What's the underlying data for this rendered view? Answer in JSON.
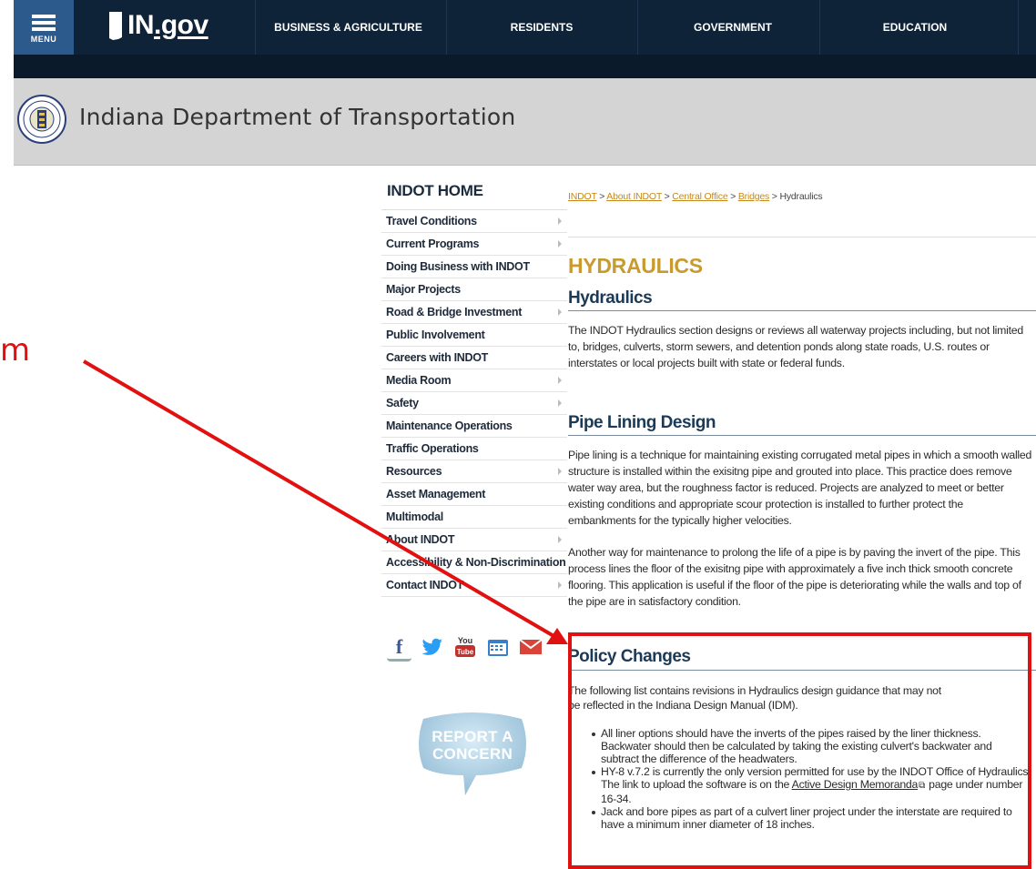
{
  "topnav": {
    "menu_label": "MENU",
    "logo_text": "IN",
    "logo_suffix": ".gov",
    "items": [
      {
        "label": "BUSINESS & AGRICULTURE"
      },
      {
        "label": "RESIDENTS"
      },
      {
        "label": "GOVERNMENT"
      },
      {
        "label": "EDUCATION"
      }
    ]
  },
  "banner": {
    "title": "Indiana Department of Transportation"
  },
  "sidebar": {
    "title": "INDOT HOME",
    "items": [
      {
        "label": "Travel Conditions",
        "has_submenu": true
      },
      {
        "label": "Current Programs",
        "has_submenu": true
      },
      {
        "label": "Doing Business with INDOT",
        "has_submenu": false
      },
      {
        "label": "Major Projects",
        "has_submenu": false
      },
      {
        "label": "Road & Bridge Investment",
        "has_submenu": true
      },
      {
        "label": "Public Involvement",
        "has_submenu": false
      },
      {
        "label": "Careers with INDOT",
        "has_submenu": false
      },
      {
        "label": "Media Room",
        "has_submenu": true
      },
      {
        "label": "Safety",
        "has_submenu": true
      },
      {
        "label": "Maintenance Operations",
        "has_submenu": false
      },
      {
        "label": "Traffic Operations",
        "has_submenu": false
      },
      {
        "label": "Resources",
        "has_submenu": true
      },
      {
        "label": "Asset Management",
        "has_submenu": false
      },
      {
        "label": "Multimodal",
        "has_submenu": false
      },
      {
        "label": "About INDOT",
        "has_submenu": true
      },
      {
        "label": "Accessibility & Non-Discrimination",
        "has_submenu": false
      },
      {
        "label": "Contact INDOT",
        "has_submenu": true
      }
    ],
    "social_icons": [
      "facebook-icon",
      "twitter-icon",
      "youtube-icon",
      "calendar-icon",
      "email-icon"
    ],
    "report_button": {
      "line1": "REPORT A",
      "line2": "CONCERN"
    }
  },
  "breadcrumb": {
    "links": [
      "INDOT",
      "About INDOT",
      "Central Office",
      "Bridges"
    ],
    "separator": ">",
    "current": "Hydraulics"
  },
  "main": {
    "page_title": "HYDRAULICS",
    "sections": [
      {
        "heading": "Hydraulics",
        "paragraphs": [
          "The INDOT Hydraulics section designs or reviews all waterway projects including, but not limited to, bridges, culverts, storm sewers, and detention ponds along state roads, U.S. routes or interstates or local projects built with state or federal funds."
        ]
      },
      {
        "heading": "Pipe Lining Design",
        "paragraphs": [
          "Pipe lining is a technique for maintaining existing corrugated metal pipes in which a smooth walled structure is installed within the exisitng pipe and grouted into place.  This practice does remove water way area, but the roughness factor is reduced.  Projects are analyzed to meet or better existing conditions and appropriate scour protection is installed to further protect the embankments for the typically higher velocities.",
          "Another way for maintenance to prolong the life of a pipe is by paving the invert of the pipe.  This process lines the floor of the exisitng pipe with approximately a five inch thick smooth concrete flooring.  This application is useful if the floor of the pipe is deteriorating while the walls and top of the pipe are in satisfactory condition."
        ]
      },
      {
        "heading": "Policy Changes",
        "intro_line1": "The following list contains revisions in Hydraulics design guidance that may not",
        "intro_line2": "be reflected in the Indiana Design Manual (IDM).",
        "bullets": [
          {
            "text": "All liner options should have the inverts of the pipes raised by the liner thickness.  Backwater should then be calculated by taking the existing culvert's backwater and subtract the difference of the headwaters."
          },
          {
            "before": "HY-8 v.7.2 is currently the only version permitted for use by the INDOT Office of Hydraulics.  The link to upload the software is on the ",
            "link": "Active Design Memoranda",
            "after": " page under number 16-34."
          },
          {
            "text": "Jack and bore pipes as part of a culvert liner project under the interstate are required to have a minimum inner diameter of 18 inches."
          }
        ]
      }
    ]
  },
  "annotation": {
    "partial_text": "m",
    "color": "#e11111"
  }
}
